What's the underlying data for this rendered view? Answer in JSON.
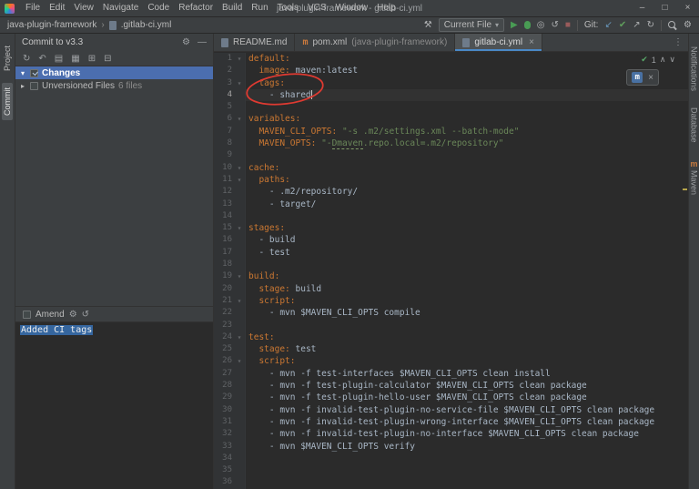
{
  "icons": {
    "minimize": "–",
    "maximize": "□",
    "close": "×",
    "hammer": "⚒",
    "combo_arrow": "▾",
    "play": "▶",
    "stop": "■",
    "git_update": "↙",
    "git_push": "↗",
    "refresh": "↻",
    "check": "✔",
    "gear": "⚙",
    "hide": "—",
    "rollback": "↶",
    "diff": "▤",
    "group": "▦",
    "expand": "⊞",
    "collapse": "⊟",
    "chevron_down": "▾",
    "chevron_right": "▸",
    "fold": "▾",
    "more": "⋮",
    "up": "∧",
    "down": "∨",
    "history": "↺",
    "coverage": "◎",
    "breadcrumb_sep": "›",
    "maven_m": "m"
  },
  "window": {
    "title": "java-plugin-framework - gitlab-ci.yml",
    "menus": [
      "File",
      "Edit",
      "View",
      "Navigate",
      "Code",
      "Refactor",
      "Build",
      "Run",
      "Tools",
      "VCS",
      "Window",
      "Help"
    ]
  },
  "nav": {
    "project": "java-plugin-framework",
    "file": ".gitlab-ci.yml",
    "run_config": "Current File",
    "git_label": "Git:"
  },
  "left_stripe": {
    "items": [
      "Project",
      "Commit"
    ]
  },
  "right_stripe": {
    "items": [
      "Notifications",
      "Database",
      "Maven"
    ]
  },
  "commit": {
    "header": "Commit to v3.3",
    "changes_label": "Changes",
    "unversioned_label": "Unversioned Files",
    "unversioned_count": "6 files",
    "amend_label": "Amend",
    "message": "Added CI tags"
  },
  "editor": {
    "tabs": [
      {
        "label": "README.md",
        "suffix": ""
      },
      {
        "label": "pom.xml",
        "suffix": "(java-plugin-framework)"
      },
      {
        "label": "gitlab-ci.yml",
        "suffix": ""
      }
    ],
    "inspections_count": "1",
    "lines": [
      {
        "n": 1,
        "fold": true,
        "tok": [
          [
            "default:",
            "key"
          ]
        ]
      },
      {
        "n": 2,
        "tok": [
          [
            "  ",
            ""
          ],
          [
            "image:",
            "key"
          ],
          [
            " maven:latest",
            ""
          ]
        ]
      },
      {
        "n": 3,
        "fold": true,
        "tok": [
          [
            "  ",
            ""
          ],
          [
            "tags:",
            "key"
          ]
        ]
      },
      {
        "n": 4,
        "cur": true,
        "caret": true,
        "tok": [
          [
            "    - shared",
            ""
          ]
        ]
      },
      {
        "n": 5,
        "tok": []
      },
      {
        "n": 6,
        "fold": true,
        "tok": [
          [
            "variables:",
            "key"
          ]
        ]
      },
      {
        "n": 7,
        "tok": [
          [
            "  ",
            ""
          ],
          [
            "MAVEN_CLI_OPTS:",
            "key"
          ],
          [
            " ",
            ""
          ],
          [
            "\"-s .m2/settings.xml --batch-mode\"",
            "str"
          ]
        ]
      },
      {
        "n": 8,
        "tok": [
          [
            "  ",
            ""
          ],
          [
            "MAVEN_OPTS:",
            "key"
          ],
          [
            " ",
            ""
          ],
          [
            "\"-",
            "str"
          ],
          [
            "Dmaven",
            "str typo"
          ],
          [
            ".repo.local=.m2/repository\"",
            "str"
          ]
        ]
      },
      {
        "n": 9,
        "tok": []
      },
      {
        "n": 10,
        "fold": true,
        "tok": [
          [
            "cache:",
            "key"
          ]
        ]
      },
      {
        "n": 11,
        "fold": true,
        "tok": [
          [
            "  ",
            ""
          ],
          [
            "paths:",
            "key"
          ]
        ]
      },
      {
        "n": 12,
        "tok": [
          [
            "    - .m2/repository/",
            ""
          ]
        ]
      },
      {
        "n": 13,
        "tok": [
          [
            "    - target/",
            ""
          ]
        ]
      },
      {
        "n": 14,
        "tok": []
      },
      {
        "n": 15,
        "fold": true,
        "tok": [
          [
            "stages:",
            "key"
          ]
        ]
      },
      {
        "n": 16,
        "tok": [
          [
            "  - build",
            ""
          ]
        ]
      },
      {
        "n": 17,
        "tok": [
          [
            "  - test",
            ""
          ]
        ]
      },
      {
        "n": 18,
        "tok": []
      },
      {
        "n": 19,
        "fold": true,
        "tok": [
          [
            "build:",
            "key"
          ]
        ]
      },
      {
        "n": 20,
        "tok": [
          [
            "  ",
            ""
          ],
          [
            "stage:",
            "key"
          ],
          [
            " build",
            ""
          ]
        ]
      },
      {
        "n": 21,
        "fold": true,
        "tok": [
          [
            "  ",
            ""
          ],
          [
            "script:",
            "key"
          ]
        ]
      },
      {
        "n": 22,
        "tok": [
          [
            "    - mvn $MAVEN_CLI_OPTS compile",
            ""
          ]
        ]
      },
      {
        "n": 23,
        "tok": []
      },
      {
        "n": 24,
        "fold": true,
        "tok": [
          [
            "test:",
            "key"
          ]
        ]
      },
      {
        "n": 25,
        "tok": [
          [
            "  ",
            ""
          ],
          [
            "stage:",
            "key"
          ],
          [
            " test",
            ""
          ]
        ]
      },
      {
        "n": 26,
        "fold": true,
        "tok": [
          [
            "  ",
            ""
          ],
          [
            "script:",
            "key"
          ]
        ]
      },
      {
        "n": 27,
        "tok": [
          [
            "    - mvn -f test-interfaces $MAVEN_CLI_OPTS clean install",
            ""
          ]
        ]
      },
      {
        "n": 28,
        "tok": [
          [
            "    - mvn -f test-plugin-calculator $MAVEN_CLI_OPTS clean package",
            ""
          ]
        ]
      },
      {
        "n": 29,
        "tok": [
          [
            "    - mvn -f test-plugin-hello-user $MAVEN_CLI_OPTS clean package",
            ""
          ]
        ]
      },
      {
        "n": 30,
        "tok": [
          [
            "    - mvn -f invalid-test-plugin-no-service-file $MAVEN_CLI_OPTS clean package",
            ""
          ]
        ]
      },
      {
        "n": 31,
        "tok": [
          [
            "    - mvn -f invalid-test-plugin-wrong-interface $MAVEN_CLI_OPTS clean package",
            ""
          ]
        ]
      },
      {
        "n": 32,
        "tok": [
          [
            "    - mvn -f invalid-test-plugin-no-interface $MAVEN_CLI_OPTS clean package",
            ""
          ]
        ]
      },
      {
        "n": 33,
        "tok": [
          [
            "    - mvn $MAVEN_CLI_OPTS verify",
            ""
          ]
        ]
      },
      {
        "n": 34,
        "tok": []
      },
      {
        "n": 35,
        "tok": []
      },
      {
        "n": 36,
        "tok": []
      }
    ]
  },
  "annotation": {
    "shape": "ellipse",
    "color": "#df3a31"
  }
}
